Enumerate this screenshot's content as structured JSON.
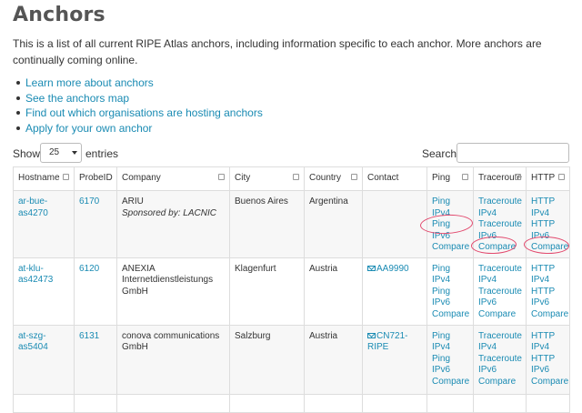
{
  "page": {
    "title": "Anchors",
    "intro": "This is a list of all current RIPE Atlas anchors, including information specific to each anchor. More anchors are continually coming online."
  },
  "links": [
    "Learn more about anchors",
    "See the anchors map",
    "Find out which organisations are hosting anchors",
    "Apply for your own anchor"
  ],
  "controls": {
    "show_label": "Show",
    "page_length": "25",
    "entries_label": "entries",
    "search_label": "Search:",
    "search_value": ""
  },
  "table": {
    "headers": [
      "Hostname",
      "ProbeID",
      "Company",
      "City",
      "Country",
      "Contact",
      "Ping",
      "Traceroute",
      "HTTP"
    ],
    "rows": [
      {
        "hostname": "ar-bue-as4270",
        "probe_id": "6170",
        "company": "ARIU",
        "sponsor": "Sponsored by: LACNIC",
        "city": "Buenos Aires",
        "country": "Argentina",
        "contact": "",
        "ping": [
          "Ping IPv4",
          "Ping IPv6",
          "Compare"
        ],
        "traceroute": [
          "Traceroute IPv4",
          "Traceroute IPv6",
          "Compare"
        ],
        "http": [
          "HTTP IPv4",
          "HTTP IPv6",
          "Compare"
        ]
      },
      {
        "hostname": "at-klu-as42473",
        "probe_id": "6120",
        "company": "ANEXIA Internetdienstleistungs GmbH",
        "sponsor": "",
        "city": "Klagenfurt",
        "country": "Austria",
        "contact": "AA9990",
        "ping": [
          "Ping IPv4",
          "Ping IPv6",
          "Compare"
        ],
        "traceroute": [
          "Traceroute IPv4",
          "Traceroute IPv6",
          "Compare"
        ],
        "http": [
          "HTTP IPv4",
          "HTTP IPv6",
          "Compare"
        ]
      },
      {
        "hostname": "at-szg-as5404",
        "probe_id": "6131",
        "company": "conova communications GmbH",
        "sponsor": "",
        "city": "Salzburg",
        "country": "Austria",
        "contact": "CN721-RIPE",
        "ping": [
          "Ping IPv4",
          "Ping IPv6",
          "Compare"
        ],
        "traceroute": [
          "Traceroute IPv4",
          "Traceroute IPv6",
          "Compare"
        ],
        "http": [
          "HTTP IPv4",
          "HTTP IPv6",
          "Compare"
        ]
      }
    ]
  },
  "colors": {
    "link": "#1a8bb3",
    "annotation": "#e24a6e",
    "border": "#dddddd"
  },
  "icons": {
    "sort": "sort-icon",
    "contact": "envelope-icon",
    "dropdown": "caret-down-icon"
  }
}
